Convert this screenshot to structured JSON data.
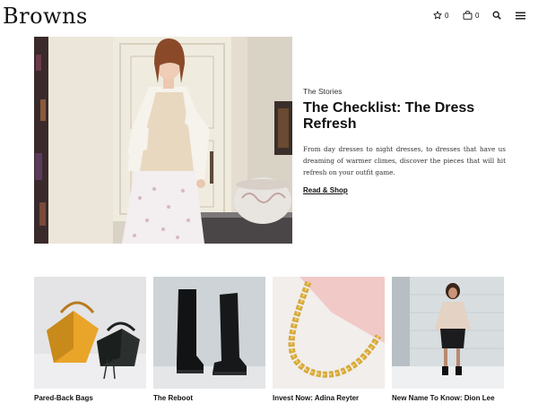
{
  "header": {
    "logo": "Browns",
    "wishlist_count": "0",
    "bag_count": "0",
    "icons": [
      "star-icon",
      "bag-icon",
      "search-icon",
      "menu-icon"
    ]
  },
  "hero": {
    "eyebrow": "The Stories",
    "headline": "The Checklist: The Dress Refresh",
    "body": "From day dresses to night dresses, to dresses that have us dreaming of warmer climes, discover the pieces that will hit refresh on your outfit game.",
    "cta": "Read & Shop"
  },
  "tiles": [
    {
      "caption": "Pared-Back Bags"
    },
    {
      "caption": "The Reboot"
    },
    {
      "caption": "Invest Now: Adina Reyter"
    },
    {
      "caption": "New Name To Know: Dion Lee"
    }
  ],
  "colors": {
    "text": "#111111",
    "background": "#ffffff"
  }
}
